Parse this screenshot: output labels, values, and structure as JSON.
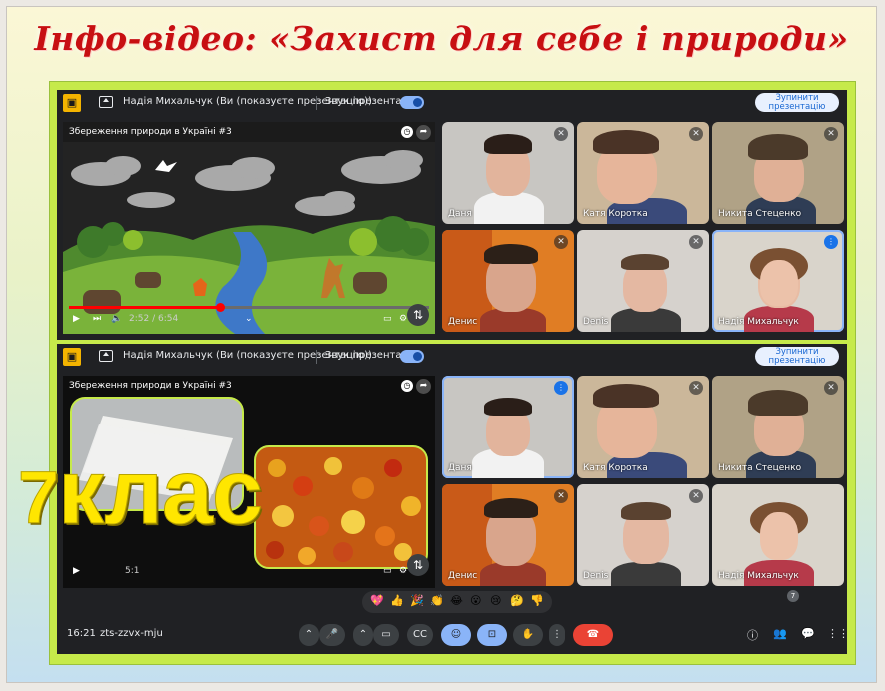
{
  "banner": {
    "title": "Інфо-відео: «Захист для себе і природи»"
  },
  "topbar": {
    "presenter": "Надія Михальчук (Ви (показуєте презентацію))",
    "sound_label": "Звук презентації",
    "stop_label": "Зупинити\nпрезентацію"
  },
  "video": {
    "title": "Збереження природи в Україні #3",
    "time_top": "2:52 / 6:54",
    "time_bottom": "5:1",
    "progress_top": 0.42
  },
  "participants_top": [
    {
      "name": "Даня",
      "muted": true
    },
    {
      "name": "Катя Коротка",
      "muted": true
    },
    {
      "name": "Никита Стеценко",
      "muted": true
    },
    {
      "name": "Денис",
      "muted": true
    },
    {
      "name": "Denis",
      "muted": true
    },
    {
      "name": "Надія Михальчук",
      "speaking": true
    }
  ],
  "participants_bottom": [
    {
      "name": "Даня",
      "speaking": true
    },
    {
      "name": "Катя Коротка",
      "muted": true
    },
    {
      "name": "Никита Стеценко",
      "muted": true
    },
    {
      "name": "Денис",
      "muted": true
    },
    {
      "name": "Denis",
      "muted": true
    },
    {
      "name": "Надія Михальчук"
    }
  ],
  "bottombar": {
    "time": "16:21",
    "meeting_code": "zts-zzvx-mju",
    "participants_count": "7"
  },
  "reactions": [
    "💖",
    "👍",
    "🎉",
    "👏",
    "😂",
    "😮",
    "😢",
    "🤔",
    "👎"
  ],
  "overlay": {
    "grade_number": "7",
    "grade_word": "клас"
  },
  "colors": {
    "banner_red": "#c70f12",
    "board_green": "#c6ea4a",
    "meet_dark": "#202124",
    "meet_blue": "#8ab4f8",
    "end_call_red": "#ea4335",
    "overlay_yellow": "#ffe600"
  }
}
